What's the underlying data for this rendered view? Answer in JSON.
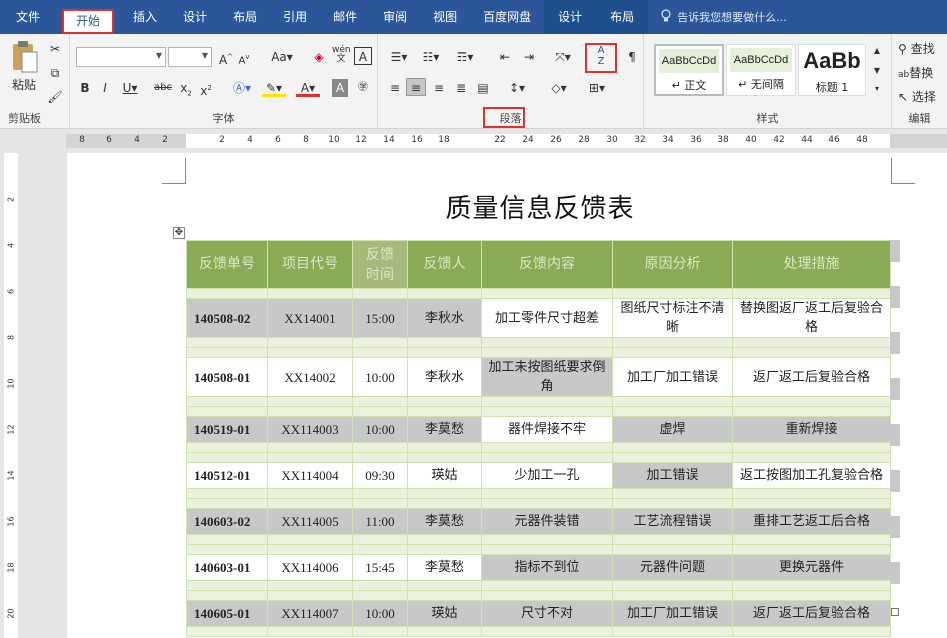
{
  "tabs": [
    "文件",
    "开始",
    "插入",
    "设计",
    "布局",
    "引用",
    "邮件",
    "审阅",
    "视图",
    "百度网盘",
    "设计",
    "布局"
  ],
  "tell_me": "告诉我您想要做什么...",
  "groups": {
    "clipboard": "剪贴板",
    "font": "字体",
    "paragraph": "段落",
    "styles": "样式",
    "editing": "编辑"
  },
  "clipboard": {
    "paste": "粘贴"
  },
  "styles": [
    {
      "preview": "AaBbCcDd",
      "name": "↵ 正文"
    },
    {
      "preview": "AaBbCcDd",
      "name": "↵ 无间隔"
    },
    {
      "preview": "AaBb",
      "name": "标题 1"
    }
  ],
  "editing": {
    "find": "查找",
    "replace": "替换",
    "select": "选择"
  },
  "ruler_numbers": [
    "8",
    "6",
    "4",
    "2",
    "2",
    "4",
    "6",
    "8",
    "10",
    "12",
    "14",
    "16",
    "18",
    "22",
    "24",
    "26",
    "28",
    "30",
    "32",
    "34",
    "36",
    "38",
    "40",
    "42",
    "44",
    "46",
    "48"
  ],
  "vruler_numbers": [
    "2",
    "4",
    "6",
    "8",
    "10",
    "12",
    "14",
    "16",
    "18",
    "20"
  ],
  "document": {
    "title": "质量信息反馈表",
    "headers": [
      "反馈单号",
      "项目代号",
      "反馈时间",
      "反馈人",
      "反馈内容",
      "原因分析",
      "处理措施"
    ],
    "rows": [
      {
        "code": "140508-02",
        "project": "XX14001",
        "time": "15:00",
        "person": "李秋水",
        "content": "加工零件尺寸超差",
        "cause": "图纸尺寸标注不清晰",
        "action": "替换图返厂返工后复验合格"
      },
      {
        "code": "140508-01",
        "project": "XX14002",
        "time": "10:00",
        "person": "李秋水",
        "content": "加工未按图纸要求倒角",
        "cause": "加工厂加工错误",
        "action": "返厂返工后复验合格"
      },
      {
        "code": "140519-01",
        "project": "XX114003",
        "time": "10:00",
        "person": "李莫愁",
        "content": "器件焊接不牢",
        "cause": "虚焊",
        "action": "重新焊接"
      },
      {
        "code": "140512-01",
        "project": "XX114004",
        "time": "09:30",
        "person": "瑛姑",
        "content": "少加工一孔",
        "cause": "加工错误",
        "action": "返工按图加工孔复验合格"
      },
      {
        "code": "140603-02",
        "project": "XX114005",
        "time": "11:00",
        "person": "李莫愁",
        "content": "元器件装错",
        "cause": "工艺流程错误",
        "action": "重排工艺返工后合格"
      },
      {
        "code": "140603-01",
        "project": "XX114006",
        "time": "15:45",
        "person": "李莫愁",
        "content": "指标不到位",
        "cause": "元器件问题",
        "action": "更换元器件"
      },
      {
        "code": "140605-01",
        "project": "XX114007",
        "time": "10:00",
        "person": "瑛姑",
        "content": "尺寸不对",
        "cause": "加工厂加工错误",
        "action": "返厂返工后复验合格"
      }
    ]
  }
}
